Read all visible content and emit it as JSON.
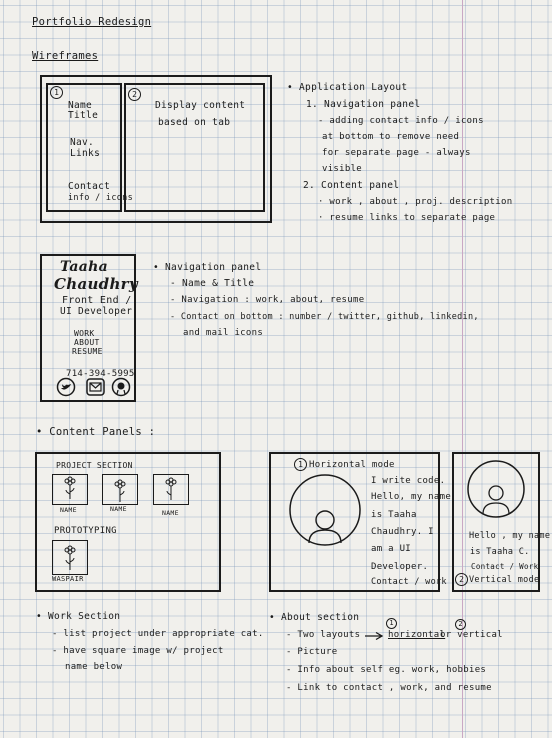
{
  "page": {
    "title": "Portfolio Redesign",
    "section": "Wireframes"
  },
  "layout_sketch": {
    "panel1_num": "1",
    "panel2_num": "2",
    "nav_name": "Name",
    "nav_title": "Title",
    "nav_links1": "Nav.",
    "nav_links2": "Links",
    "nav_contact1": "Contact",
    "nav_contact2": "info / icons",
    "content1": "Display  content",
    "content2": "based  on  tab"
  },
  "layout_notes": [
    "• Application  Layout",
    "1.  Navigation  panel",
    "- adding  contact  info / icons",
    "at  bottom  to  remove  need",
    "for  separate  page  -  always",
    "visible",
    "2.  Content  panel",
    "·  work ,  about ,  proj. description",
    "·  resume  links  to  separate page"
  ],
  "nav_sketch": {
    "name_script1": "Taaha",
    "name_script2": "Chaudhry",
    "title1": "Front End /",
    "title2": "UI  Developer",
    "link_work": "WORK",
    "link_about": "ABOUT",
    "link_resume": "RESUME",
    "phone": "714-394-5995"
  },
  "nav_notes": [
    "• Navigation  panel",
    "- Name  &  Title",
    "- Navigation :  work,  about,  resume",
    "- Contact  on  bottom :  number / twitter, github, linkedin,",
    "and  mail   icons"
  ],
  "content_heading": "• Content   Panels :",
  "work_sketch": {
    "project_section": "PROJECT  SECTION",
    "name1": "NAME",
    "name2": "NAME",
    "name3": "NAME",
    "prototyping": "PROTOTYPING",
    "waspair": "WASPAIR"
  },
  "about_horizontal": {
    "num": "1",
    "label": "Horizontal  mode",
    "lines": [
      "I  write  code.",
      "Hello, my  name",
      "is  Taaha",
      "Chaudhry.  I",
      "am  a  UI",
      "Developer.",
      "Contact / work"
    ]
  },
  "about_vertical": {
    "lines": [
      "Hello ,  my  name",
      "is  Taaha  C.",
      "Contact / Work"
    ],
    "num": "2",
    "label": "Vertical  mode"
  },
  "work_notes": [
    "• Work    Section",
    "-  list  project  under  appropriate  cat.",
    "-  have   square  image  w/ project",
    "name    below"
  ],
  "about_notes": [
    "• About  section",
    "-  Two  layouts",
    "horizontal",
    "or  vertical",
    "-  Picture",
    "-  Info   about  self  eg.  work,  hobbies",
    "-  Link   to   contact ,  work,  and  resume"
  ],
  "about_note_nums": [
    "1",
    "2"
  ],
  "icons": [
    "twitter-icon",
    "mail-icon",
    "github-icon",
    "flower-image-icon",
    "avatar-icon",
    "arrow-right-icon"
  ]
}
